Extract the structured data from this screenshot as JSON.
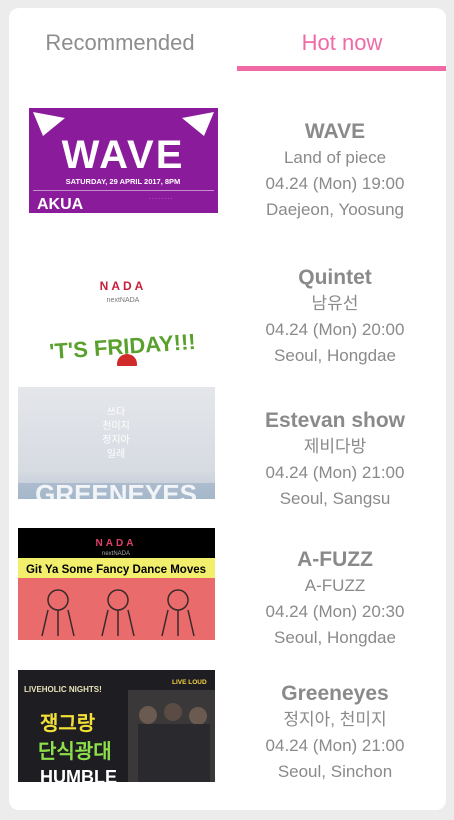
{
  "tabs": {
    "recommended": "Recommended",
    "hot_now": "Hot now",
    "active": "hot_now"
  },
  "colors": {
    "accent": "#f06aa6",
    "text": "#8a8a8a",
    "inactive_tab": "#8d8d8d"
  },
  "events": [
    {
      "title": "WAVE",
      "subtitle": "Land of piece",
      "datetime": "04.24 (Mon) 19:00",
      "location": "Daejeon, Yoosung",
      "poster": {
        "headline": "WAVE",
        "date_line": "SATURDAY, 29 APRIL 2017, 8PM",
        "venue": "AKUA"
      }
    },
    {
      "title": "Quintet",
      "subtitle": "남유선",
      "datetime": "04.24 (Mon) 20:00",
      "location": "Seoul, Hongdae",
      "poster": {
        "logo": "NADA",
        "logo_sub": "nextNADA",
        "headline": "'T'S FRIDAY!!!"
      }
    },
    {
      "title": "Estevan show",
      "subtitle": "제비다방",
      "datetime": "04.24 (Mon) 21:00",
      "location": "Seoul, Sangsu",
      "poster": {
        "lines": [
          "쓰다",
          "천미지",
          "정지아",
          "일레"
        ],
        "bottom_text": "GREENEYES"
      }
    },
    {
      "title": "A-FUZZ",
      "subtitle": "A-FUZZ",
      "datetime": "04.24 (Mon) 20:30",
      "location": "Seoul, Hongdae",
      "poster": {
        "logo": "NADA",
        "logo_sub": "nextNADA",
        "headline": "Git Ya Some Fancy Dance Moves"
      }
    },
    {
      "title": "Greeneyes",
      "subtitle": "정지아, 천미지",
      "datetime": "04.24 (Mon) 21:00",
      "location": "Seoul, Sinchon",
      "poster": {
        "top_line": "LIVEHOLIC NIGHTS!",
        "badge": "LIVE LOUD",
        "line1": "쟁그랑",
        "line2": "단식광대",
        "bottom": "HUMBLE"
      }
    }
  ]
}
